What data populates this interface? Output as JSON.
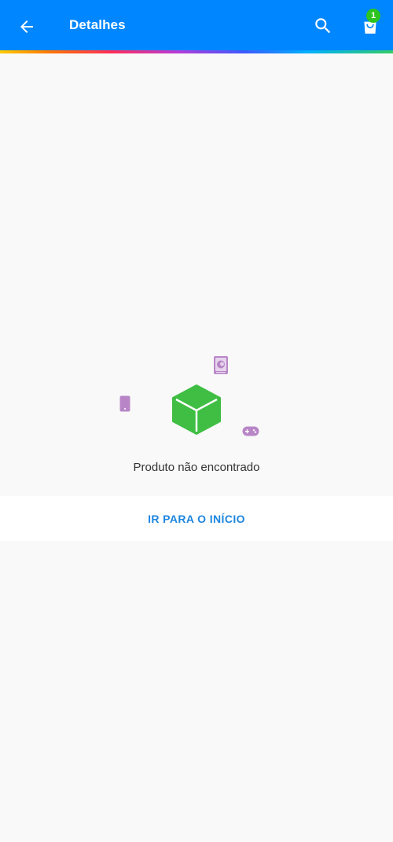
{
  "header": {
    "title": "Detalhes",
    "back_icon": "arrow-left-icon",
    "search_icon": "search-icon",
    "cart_icon": "shopping-bag-icon",
    "cart_count": "1",
    "background_color": "#0086ff",
    "badge_color": "#2ec41f"
  },
  "empty_state": {
    "icons": [
      "smartphone-icon",
      "book-icon",
      "box-icon",
      "gamepad-icon"
    ],
    "box_color": "#3fbe43",
    "accent_icon_color": "#b886c7",
    "message": "Produto não encontrado"
  },
  "action": {
    "label": "IR PARA O INÍCIO",
    "color": "#1d86e0"
  }
}
